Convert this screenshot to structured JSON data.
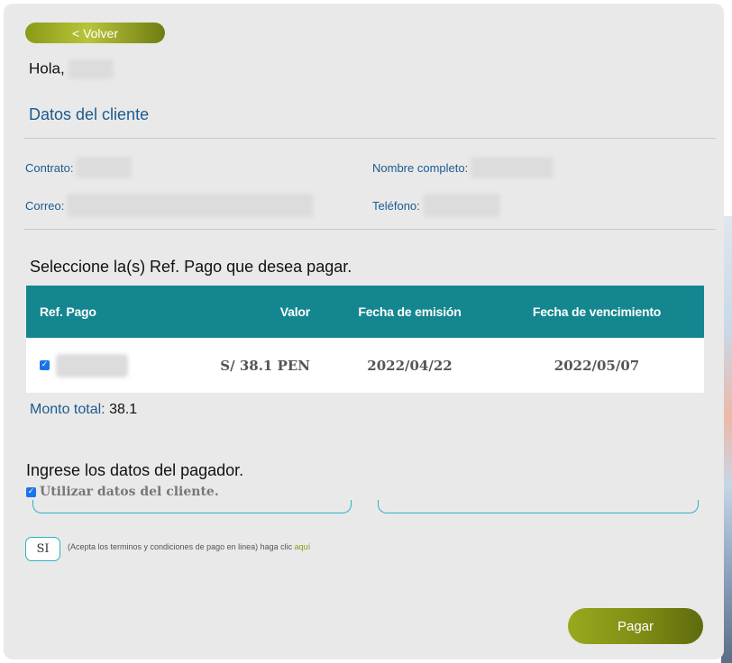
{
  "header": {
    "back_label": "< Volver",
    "greeting": "Hola,"
  },
  "client": {
    "title": "Datos del cliente",
    "contract_label": "Contrato:",
    "fullname_label": "Nombre completo:",
    "email_label": "Correo:",
    "phone_label": "Teléfono:"
  },
  "refs": {
    "title": "Seleccione la(s) Ref. Pago que desea pagar.",
    "columns": [
      "Ref. Pago",
      "Valor",
      "Fecha de emisión",
      "Fecha de vencimiento"
    ],
    "rows": [
      {
        "checked": true,
        "value": "S/ 38.1 PEN",
        "issue_date": "2022/04/22",
        "due_date": "2022/05/07"
      }
    ]
  },
  "total": {
    "label": "Monto total:",
    "value": "38.1"
  },
  "payer": {
    "title": "Ingrese los datos del pagador.",
    "use_client_label": "Utilizar datos del cliente."
  },
  "terms": {
    "si_label": "SI",
    "text": "(Acepta los terminos y condiciones de pago en linea) haga clic",
    "link": "aquí"
  },
  "actions": {
    "pay_label": "Pagar"
  },
  "colors": {
    "accent_olive": "#8a9a16",
    "teal_header": "#14868f",
    "link_blue": "#1b5a8e"
  }
}
